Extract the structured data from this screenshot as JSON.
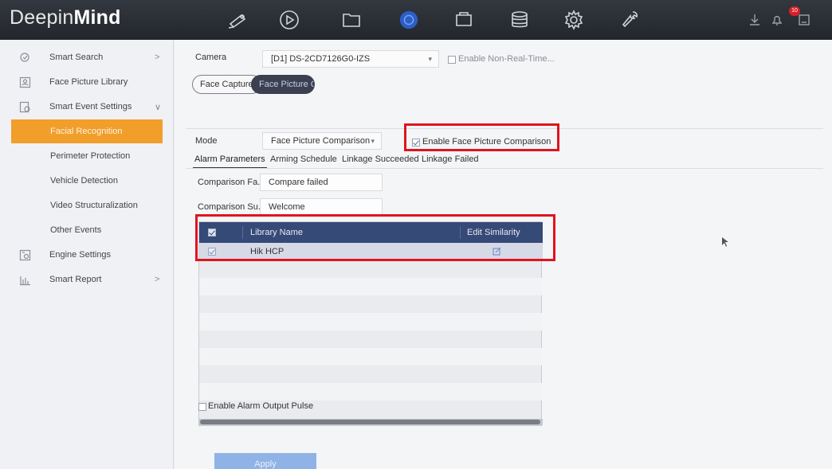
{
  "brand": {
    "prefix": "Deepin",
    "bold": "Mind"
  },
  "topbar": {
    "icons": [
      "live-view-icon",
      "playback-icon",
      "file-icon",
      "smart-analysis-icon",
      "configuration-icon",
      "storage-icon",
      "system-settings-icon",
      "maintenance-icon"
    ],
    "active": "smart-analysis-icon",
    "right_icons": [
      "download-icon",
      "alarm-bell-icon",
      "task-icon"
    ],
    "alarm_count": "10",
    "accent_color": "#2b5fc7"
  },
  "sidebar": {
    "items": [
      {
        "label": "Smart Search",
        "icon": "smart-search-icon",
        "arrow": ">"
      },
      {
        "label": "Face Picture Library",
        "icon": "face-library-icon"
      },
      {
        "label": "Smart Event Settings",
        "icon": "event-settings-icon",
        "arrow": "∨"
      },
      {
        "label": "Facial Recognition",
        "active": true
      },
      {
        "label": "Perimeter Protection"
      },
      {
        "label": "Vehicle Detection"
      },
      {
        "label": "Video Structuralization"
      },
      {
        "label": "Other Events"
      },
      {
        "label": "Engine Settings",
        "icon": "engine-settings-icon"
      },
      {
        "label": "Smart Report",
        "icon": "smart-report-icon",
        "arrow": ">"
      }
    ],
    "active_color": "#f19e2b"
  },
  "main": {
    "camera_label": "Camera",
    "camera_value": "[D1] DS-2CD7126G0-IZS",
    "non_realtime_label": "Enable Non-Real-Time...",
    "subtabs": [
      "Face Capture",
      "Face Picture C..."
    ],
    "mode_label": "Mode",
    "mode_value": "Face Picture Comparison",
    "enable_comparison_label": "Enable Face Picture Comparison",
    "tabs": [
      "Alarm Parameters",
      "Arming Schedule",
      "Linkage Succeeded",
      "Linkage Failed"
    ],
    "fail_label": "Comparison Fa...",
    "fail_value": "Compare failed",
    "success_label": "Comparison Su...",
    "success_value": "Welcome",
    "table": {
      "headers": [
        "Library Name",
        "Edit Similarity"
      ],
      "rows": [
        {
          "name": "Hik HCP",
          "checked": true
        }
      ]
    },
    "alarm_pulse_label": "Enable Alarm Output Pulse",
    "apply_label": "Apply"
  },
  "highlight_color": "#e0141e"
}
